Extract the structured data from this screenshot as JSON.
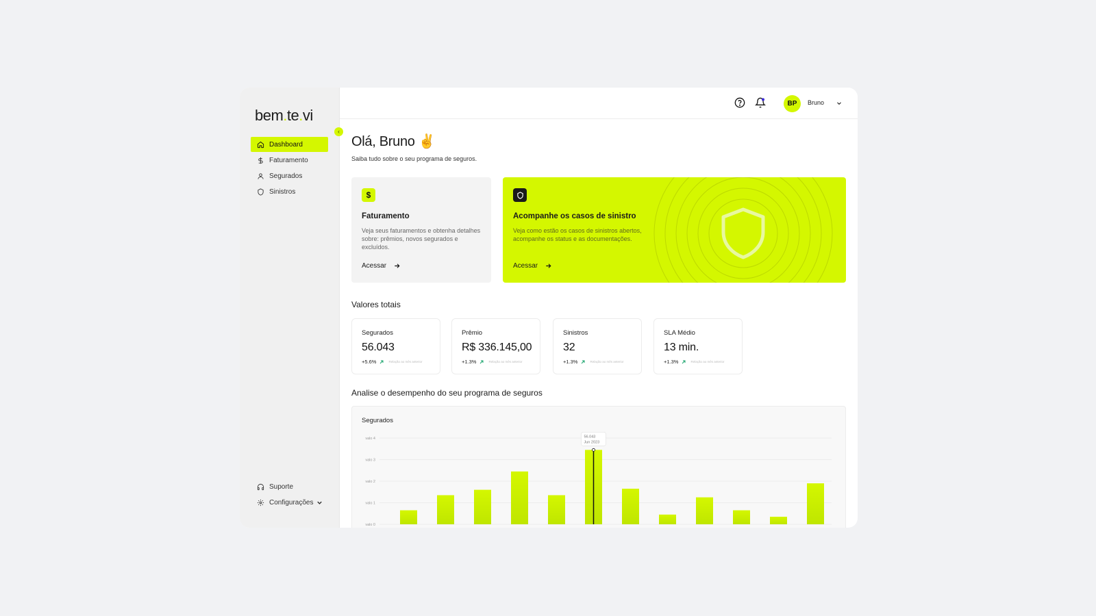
{
  "app": {
    "logo": "bem.te.vi",
    "logo_parts": [
      "bem",
      ".",
      "te",
      ".",
      "vi"
    ]
  },
  "sidebar": {
    "items": [
      {
        "label": "Dashboard",
        "icon": "home-icon",
        "active": true
      },
      {
        "label": "Faturamento",
        "icon": "dollar-icon"
      },
      {
        "label": "Segurados",
        "icon": "user-icon"
      },
      {
        "label": "Sinistros",
        "icon": "shield-icon"
      }
    ],
    "bottom": [
      {
        "label": "Suporte",
        "icon": "headphones-icon"
      },
      {
        "label": "Configurações",
        "icon": "gear-icon"
      }
    ]
  },
  "header": {
    "help_icon": "help-circle-icon",
    "bell_icon": "bell-icon",
    "avatar_initials": "BP",
    "user_name": "Bruno"
  },
  "main": {
    "greeting": "Olá, Bruno ✌️",
    "subtitle": "Saiba tudo sobre o seu programa de seguros.",
    "cards": [
      {
        "title": "Faturamento",
        "description": "Veja seus faturamentos e obtenha detalhes sobre: prêmios, novos segurados e excluídos.",
        "link": "Acessar",
        "icon": "dollar-icon"
      },
      {
        "title": "Acompanhe os casos de sinistro",
        "description": "Veja como estão os casos de sinistros abertos, acompanhe os status e as documentações.",
        "link": "Acessar",
        "icon": "shield-icon"
      }
    ],
    "totals_title": "Valores totais",
    "stats": [
      {
        "label": "Segurados",
        "value": "56.043",
        "delta": "+5.6%",
        "note": "Relação ao mês anterior"
      },
      {
        "label": "Prêmio",
        "value": "R$ 336.145,00",
        "delta": "+1.3%",
        "note": "Relação ao mês anterior"
      },
      {
        "label": "Sinistros",
        "value": "32",
        "delta": "+1.3%",
        "note": "Relação ao mês anterior"
      },
      {
        "label": "SLA Médio",
        "value": "13 min.",
        "delta": "+1.3%",
        "note": "Relação ao mês anterior"
      }
    ],
    "performance_title": "Analise o desempenho do seu programa de seguros"
  },
  "colors": {
    "accent": "#d4f700",
    "background": "#f1f2f4",
    "text": "#1b1b1b"
  },
  "chart_data": {
    "type": "bar",
    "title": "Segurados",
    "ylim": [
      0,
      4
    ],
    "y_ticks": [
      "valo 0",
      "valo 1",
      "valo 2",
      "valo 3",
      "valo 4"
    ],
    "values": [
      0.65,
      1.35,
      1.6,
      2.45,
      1.35,
      3.45,
      1.65,
      0.45,
      1.25,
      0.65,
      0.35,
      1.9
    ],
    "highlight_index": 5,
    "tooltip": {
      "value": "56.043",
      "date": "Jun 2023"
    },
    "grid": true
  }
}
